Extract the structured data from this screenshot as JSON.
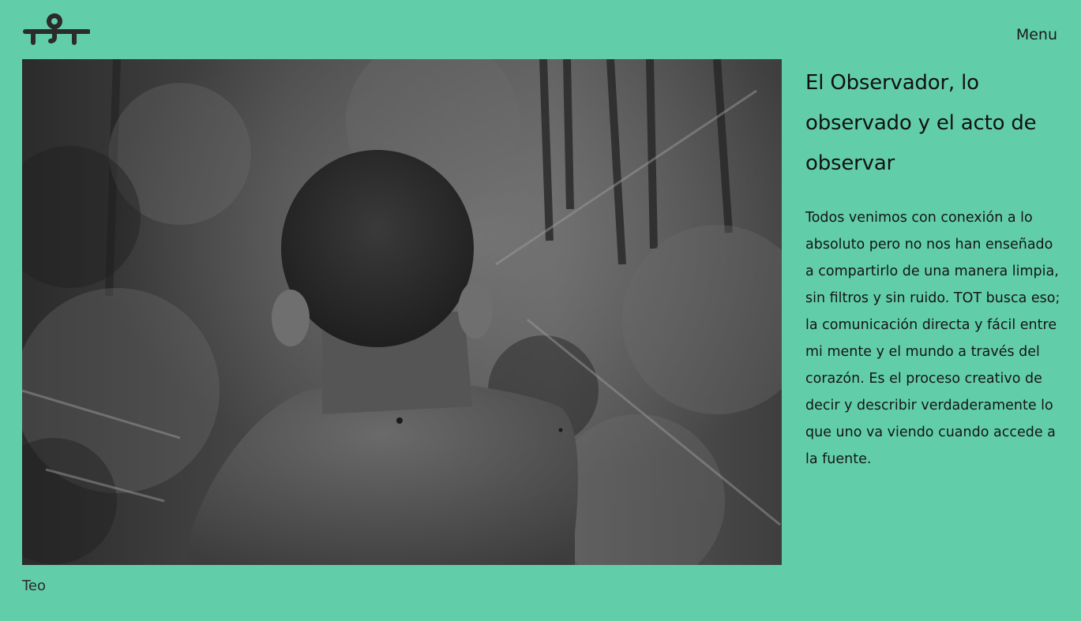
{
  "theme": {
    "background": "#62cea9",
    "logo_color": "#2b2b2b"
  },
  "header": {
    "logo_icon": "tot-logo-icon",
    "menu_label": "Menu"
  },
  "main": {
    "photo_subject": "Black and white photograph of a boy seen from behind in a forest",
    "caption": "Teo"
  },
  "article": {
    "title": "El Observador, lo observado y el acto de observar",
    "body": "Todos venimos con conexión a lo absoluto pero no nos han enseñado a compartirlo de una manera limpia, sin filtros y sin ruido. TOT busca eso; la comunicación directa y fácil entre mi mente y el mundo a través del corazón. Es el proceso creativo de decir y describir verdaderamente lo que uno va viendo cuando accede a la fuente."
  }
}
